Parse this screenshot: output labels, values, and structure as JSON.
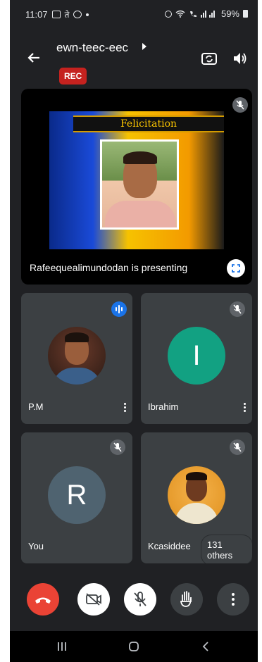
{
  "status_bar": {
    "time": "11:07",
    "battery": "59%",
    "icons": [
      "gallery-icon",
      "app-icon",
      "whatsapp-icon",
      "dot-icon",
      "alarm-icon",
      "wifi-icon",
      "call-wifi-icon",
      "signal-icon",
      "battery-icon"
    ]
  },
  "header": {
    "meeting_title": "ewn-teec-eec",
    "rec_badge": "REC",
    "icons": [
      "back-arrow-icon",
      "switch-camera-icon",
      "speaker-icon"
    ]
  },
  "presentation": {
    "slide_title": "Felicitation",
    "presenter_label": "Rafeequealimundodan is presenting",
    "icons": [
      "mic-off-icon",
      "fullscreen-icon"
    ]
  },
  "participants": [
    {
      "name": "P.M",
      "avatar_type": "photo",
      "status": "speaking",
      "color": "#1a73e8"
    },
    {
      "name": "Ibrahim",
      "avatar_type": "letter",
      "letter": "I",
      "status": "muted",
      "color": "#12a182"
    },
    {
      "name": "You",
      "avatar_type": "letter",
      "letter": "R",
      "status": "muted",
      "color": "#4f6370"
    },
    {
      "name": "Kcasiddee",
      "avatar_type": "photo",
      "status": "muted",
      "others_label": "131 others"
    }
  ],
  "controls": {
    "buttons": [
      "end-call",
      "camera-off",
      "mic-off",
      "raise-hand",
      "more-options"
    ],
    "colors": {
      "end_call": "#ea4335",
      "white": "#ffffff",
      "dark": "#3c4043"
    }
  },
  "nav_bar": {
    "buttons": [
      "recents",
      "home",
      "back"
    ]
  },
  "theme": {
    "background": "#202124",
    "tile": "#3c4043",
    "rec": "#c5221f"
  }
}
